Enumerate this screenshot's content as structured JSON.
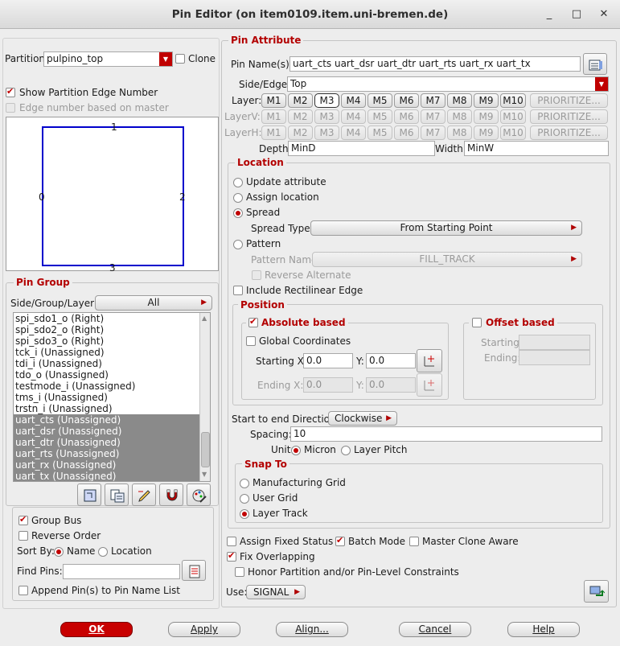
{
  "window": {
    "title": "Pin Editor (on item0109.item.uni-bremen.de)",
    "close": "✕",
    "minimize": "_",
    "maximize": "□"
  },
  "left": {
    "partition_label": "Partition:",
    "partition_value": "pulpino_top",
    "clone_label": "Clone",
    "show_edge_label": "Show Partition Edge Number",
    "edge_master_label": "Edge number based on master",
    "edges": {
      "top": "1",
      "left": "0",
      "right": "2",
      "bottom": "3"
    },
    "pin_group_title": "Pin Group",
    "sgl_label": "Side/Group/Layer:",
    "sgl_value": "All",
    "pins": [
      {
        "text": "spi_sdo1_o (Right)",
        "selected": false
      },
      {
        "text": "spi_sdo2_o (Right)",
        "selected": false
      },
      {
        "text": "spi_sdo3_o (Right)",
        "selected": false
      },
      {
        "text": "tck_i (Unassigned)",
        "selected": false
      },
      {
        "text": "tdi_i (Unassigned)",
        "selected": false
      },
      {
        "text": "tdo_o (Unassigned)",
        "selected": false
      },
      {
        "text": "testmode_i (Unassigned)",
        "selected": false
      },
      {
        "text": "tms_i (Unassigned)",
        "selected": false
      },
      {
        "text": "trstn_i (Unassigned)",
        "selected": false
      },
      {
        "text": "uart_cts (Unassigned)",
        "selected": true
      },
      {
        "text": "uart_dsr (Unassigned)",
        "selected": true
      },
      {
        "text": "uart_dtr (Unassigned)",
        "selected": true
      },
      {
        "text": "uart_rts (Unassigned)",
        "selected": true
      },
      {
        "text": "uart_rx (Unassigned)",
        "selected": true
      },
      {
        "text": "uart_tx (Unassigned)",
        "selected": true
      }
    ],
    "group_bus_label": "Group Bus",
    "reverse_order_label": "Reverse Order",
    "sort_by_label": "Sort By:",
    "sort_name_label": "Name",
    "sort_location_label": "Location",
    "find_pins_label": "Find Pins:",
    "find_pins_value": "",
    "append_label": "Append Pin(s) to Pin Name List"
  },
  "right": {
    "pin_attribute_title": "Pin Attribute",
    "pin_names_label": "Pin Name(s):",
    "pin_names_value": "uart_cts uart_dsr uart_dtr uart_rts uart_rx uart_tx",
    "side_edge_label": "Side/Edge:",
    "side_edge_value": "Top",
    "layer_label": "Layer:",
    "layerv_label": "LayerV:",
    "layerh_label": "LayerH:",
    "layers": [
      "M1",
      "M2",
      "M3",
      "M4",
      "M5",
      "M6",
      "M7",
      "M8",
      "M9",
      "M10"
    ],
    "prioritize_label": "PRIORITIZE...",
    "depth_label": "Depth:",
    "depth_value": "MinD",
    "width_label": "Width:",
    "width_value": "MinW",
    "location_title": "Location",
    "update_attr_label": "Update attribute",
    "assign_loc_label": "Assign location",
    "spread_label": "Spread",
    "spread_type_label": "Spread Type",
    "spread_type_value": "From Starting Point",
    "pattern_label": "Pattern",
    "pattern_name_label": "Pattern Name",
    "pattern_name_value": "FILL_TRACK",
    "reverse_alt_label": "Reverse Alternate",
    "include_rect_label": "Include Rectilinear Edge",
    "position_title": "Position",
    "absolute_label": "Absolute based",
    "global_coord_label": "Global Coordinates",
    "starting_x_label": "Starting X:",
    "starting_x_value": "0.0",
    "y_label": "Y:",
    "starting_y_value": "0.0",
    "ending_x_label": "Ending X:",
    "ending_x_value": "0.0",
    "ending_y_value": "0.0",
    "offset_label": "Offset based",
    "offset_starting_label": "Starting:",
    "offset_ending_label": "Ending:",
    "direction_label": "Start to end Direction",
    "direction_value": "Clockwise",
    "spacing_label": "Spacing:",
    "spacing_value": "10",
    "unit_label": "Unit:",
    "unit_micron_label": "Micron",
    "unit_pitch_label": "Layer Pitch",
    "snap_title": "Snap To",
    "snap_mfg_label": "Manufacturing Grid",
    "snap_user_label": "User Grid",
    "snap_track_label": "Layer Track",
    "assign_fixed_label": "Assign Fixed Status",
    "batch_mode_label": "Batch Mode",
    "master_clone_label": "Master Clone Aware",
    "fix_overlap_label": "Fix Overlapping",
    "honor_label": "Honor Partition and/or Pin-Level Constraints",
    "use_label": "Use:",
    "use_value": "SIGNAL"
  },
  "buttons": {
    "ok": "OK",
    "apply": "Apply",
    "align": "Align...",
    "cancel": "Cancel",
    "help": "Help"
  },
  "colors": {
    "accent": "#c00000",
    "partition_box": "#0000cc",
    "selection": "#8a8a8a"
  }
}
